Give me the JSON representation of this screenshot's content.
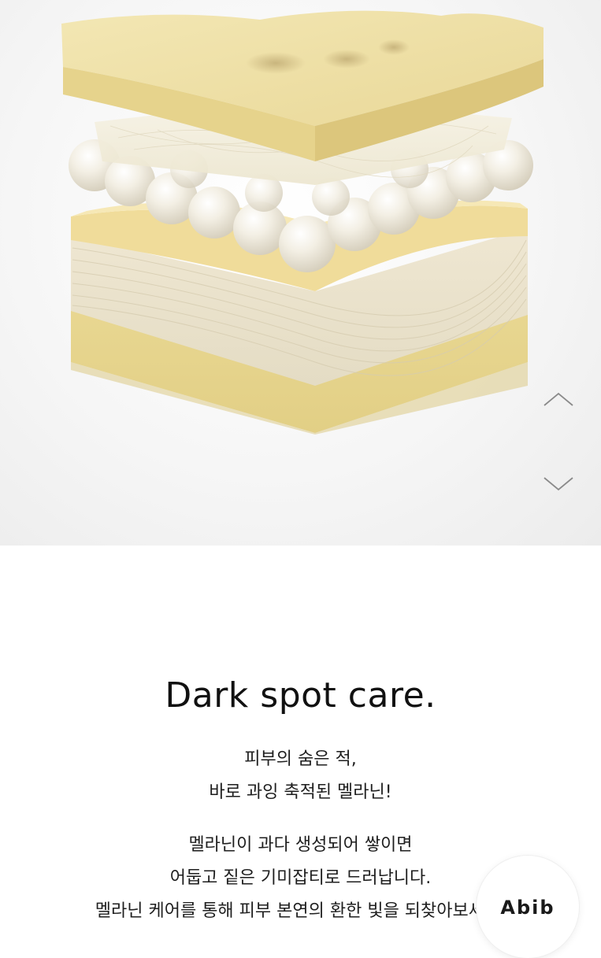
{
  "hero": {
    "image_subject": "layered skin illustration with pearl spheres",
    "icons": {
      "up": "chevron-up-icon",
      "down": "chevron-down-icon"
    }
  },
  "content": {
    "headline": "Dark spot care.",
    "intro_lines": [
      "피부의 숨은 적,",
      "바로 과잉 축적된 멜라닌!"
    ],
    "body_lines": [
      "멜라닌이 과다 생성되어 쌓이면",
      "어둡고 짙은 기미잡티로 드러납니다.",
      "멜라닌 케어를 통해 피부 본연의 환한 빛을 되찾아보세요."
    ]
  },
  "badge": {
    "label": "Abib"
  },
  "colors": {
    "skin_top": "#efe2a8",
    "skin_side": "#e6d58f",
    "pearl": "#f4f1ea",
    "text": "#1a1a1a",
    "arrow": "#8a8a8a"
  }
}
